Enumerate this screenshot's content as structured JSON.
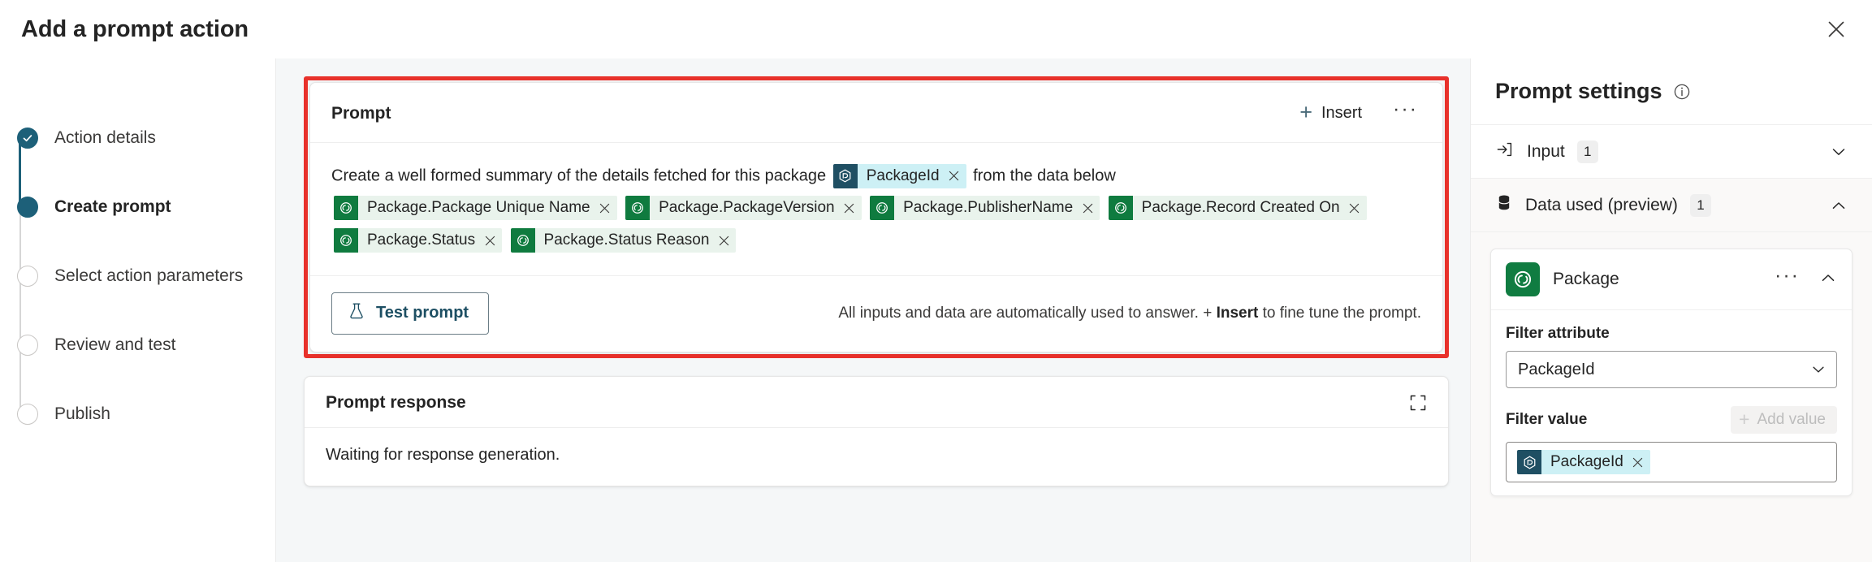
{
  "window": {
    "title": "Add a prompt action",
    "close_label": "✕"
  },
  "stepper": {
    "steps": [
      {
        "label": "Action details",
        "state": "done"
      },
      {
        "label": "Create prompt",
        "state": "current"
      },
      {
        "label": "Select action parameters",
        "state": "todo"
      },
      {
        "label": "Review and test",
        "state": "todo"
      },
      {
        "label": "Publish",
        "state": "todo"
      }
    ]
  },
  "prompt_card": {
    "title": "Prompt",
    "insert_label": "Insert",
    "more_label": "···",
    "text_before": "Create a well formed summary of the details fetched for this package",
    "text_after": "from the data below",
    "inline_token": {
      "label": "PackageId",
      "color": "blue"
    },
    "data_tokens": [
      {
        "label": "Package.Package Unique Name",
        "color": "green"
      },
      {
        "label": "Package.PackageVersion",
        "color": "green"
      },
      {
        "label": "Package.PublisherName",
        "color": "green"
      },
      {
        "label": "Package.Record Created On",
        "color": "green"
      },
      {
        "label": "Package.Status",
        "color": "green"
      },
      {
        "label": "Package.Status Reason",
        "color": "green"
      }
    ],
    "test_button": "Test prompt",
    "hint_part1": "All inputs and data are automatically used to answer. + ",
    "hint_bold": "Insert",
    "hint_part2": " to fine tune the prompt."
  },
  "response_card": {
    "title": "Prompt response",
    "body_text": "Waiting for response generation.",
    "expand_label": "expand-icon"
  },
  "settings": {
    "title": "Prompt settings",
    "input_section": {
      "label": "Input",
      "count": "1",
      "expanded": false
    },
    "data_section": {
      "label": "Data used (preview)",
      "count": "1",
      "expanded": true
    },
    "entity": {
      "name": "Package",
      "filter_attribute_label": "Filter attribute",
      "filter_attribute_value": "PackageId",
      "filter_value_label": "Filter value",
      "add_value_label": "Add value",
      "value_token": {
        "label": "PackageId",
        "color": "blue"
      },
      "more_label": "···"
    }
  },
  "colors": {
    "accent_teal": "#1d6079",
    "token_blue_icon": "#1f4f63",
    "token_blue_bg": "#cdf0f5",
    "token_green_icon": "#0f7b3f",
    "token_green_bg": "#e9f3ec",
    "highlight_red": "#e8312b",
    "entity_green": "#107c41",
    "canvas_bg": "#f5f7f8"
  },
  "icons": {
    "close": "close-icon",
    "plus": "plus-icon",
    "flask": "flask-icon",
    "info": "info-icon",
    "input_arrow": "arrow-into-bracket-icon",
    "database": "database-icon",
    "chevron_down": "chevron-down-icon",
    "chevron_up": "chevron-up-icon"
  }
}
